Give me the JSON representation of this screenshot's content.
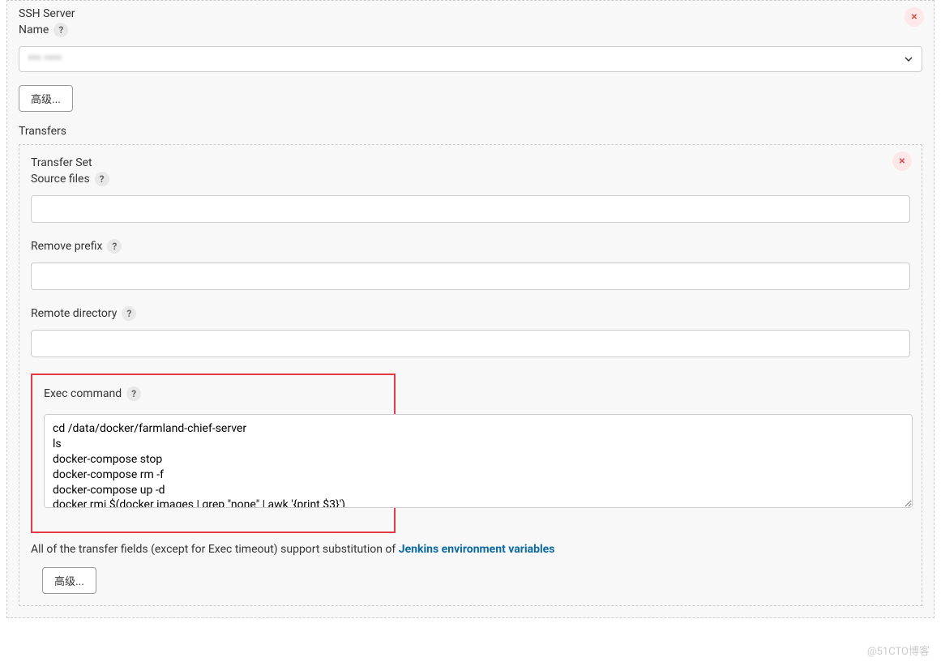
{
  "sshServer": {
    "title": "SSH Server",
    "nameLabel": "Name",
    "nameValue": "*** ****",
    "advancedBtn": "高级..."
  },
  "transfers": {
    "title": "Transfers",
    "setLabel": "Transfer Set",
    "sourceFilesLabel": "Source files",
    "sourceFilesValue": "",
    "removePrefixLabel": "Remove prefix",
    "removePrefixValue": "",
    "remoteDirLabel": "Remote directory",
    "remoteDirValue": "",
    "execCommandLabel": "Exec command",
    "execCommandValue": "cd /data/docker/farmland-chief-server\nls\ndocker-compose stop\ndocker-compose rm -f\ndocker-compose up -d\ndocker rmi $(docker images | grep \"none\" | awk '{print $3}')",
    "noteText": "All of the transfer fields (except for Exec timeout) support substitution of ",
    "noteLink": "Jenkins environment variables",
    "advancedBtn": "高级..."
  },
  "watermark": "@51CTO博客"
}
